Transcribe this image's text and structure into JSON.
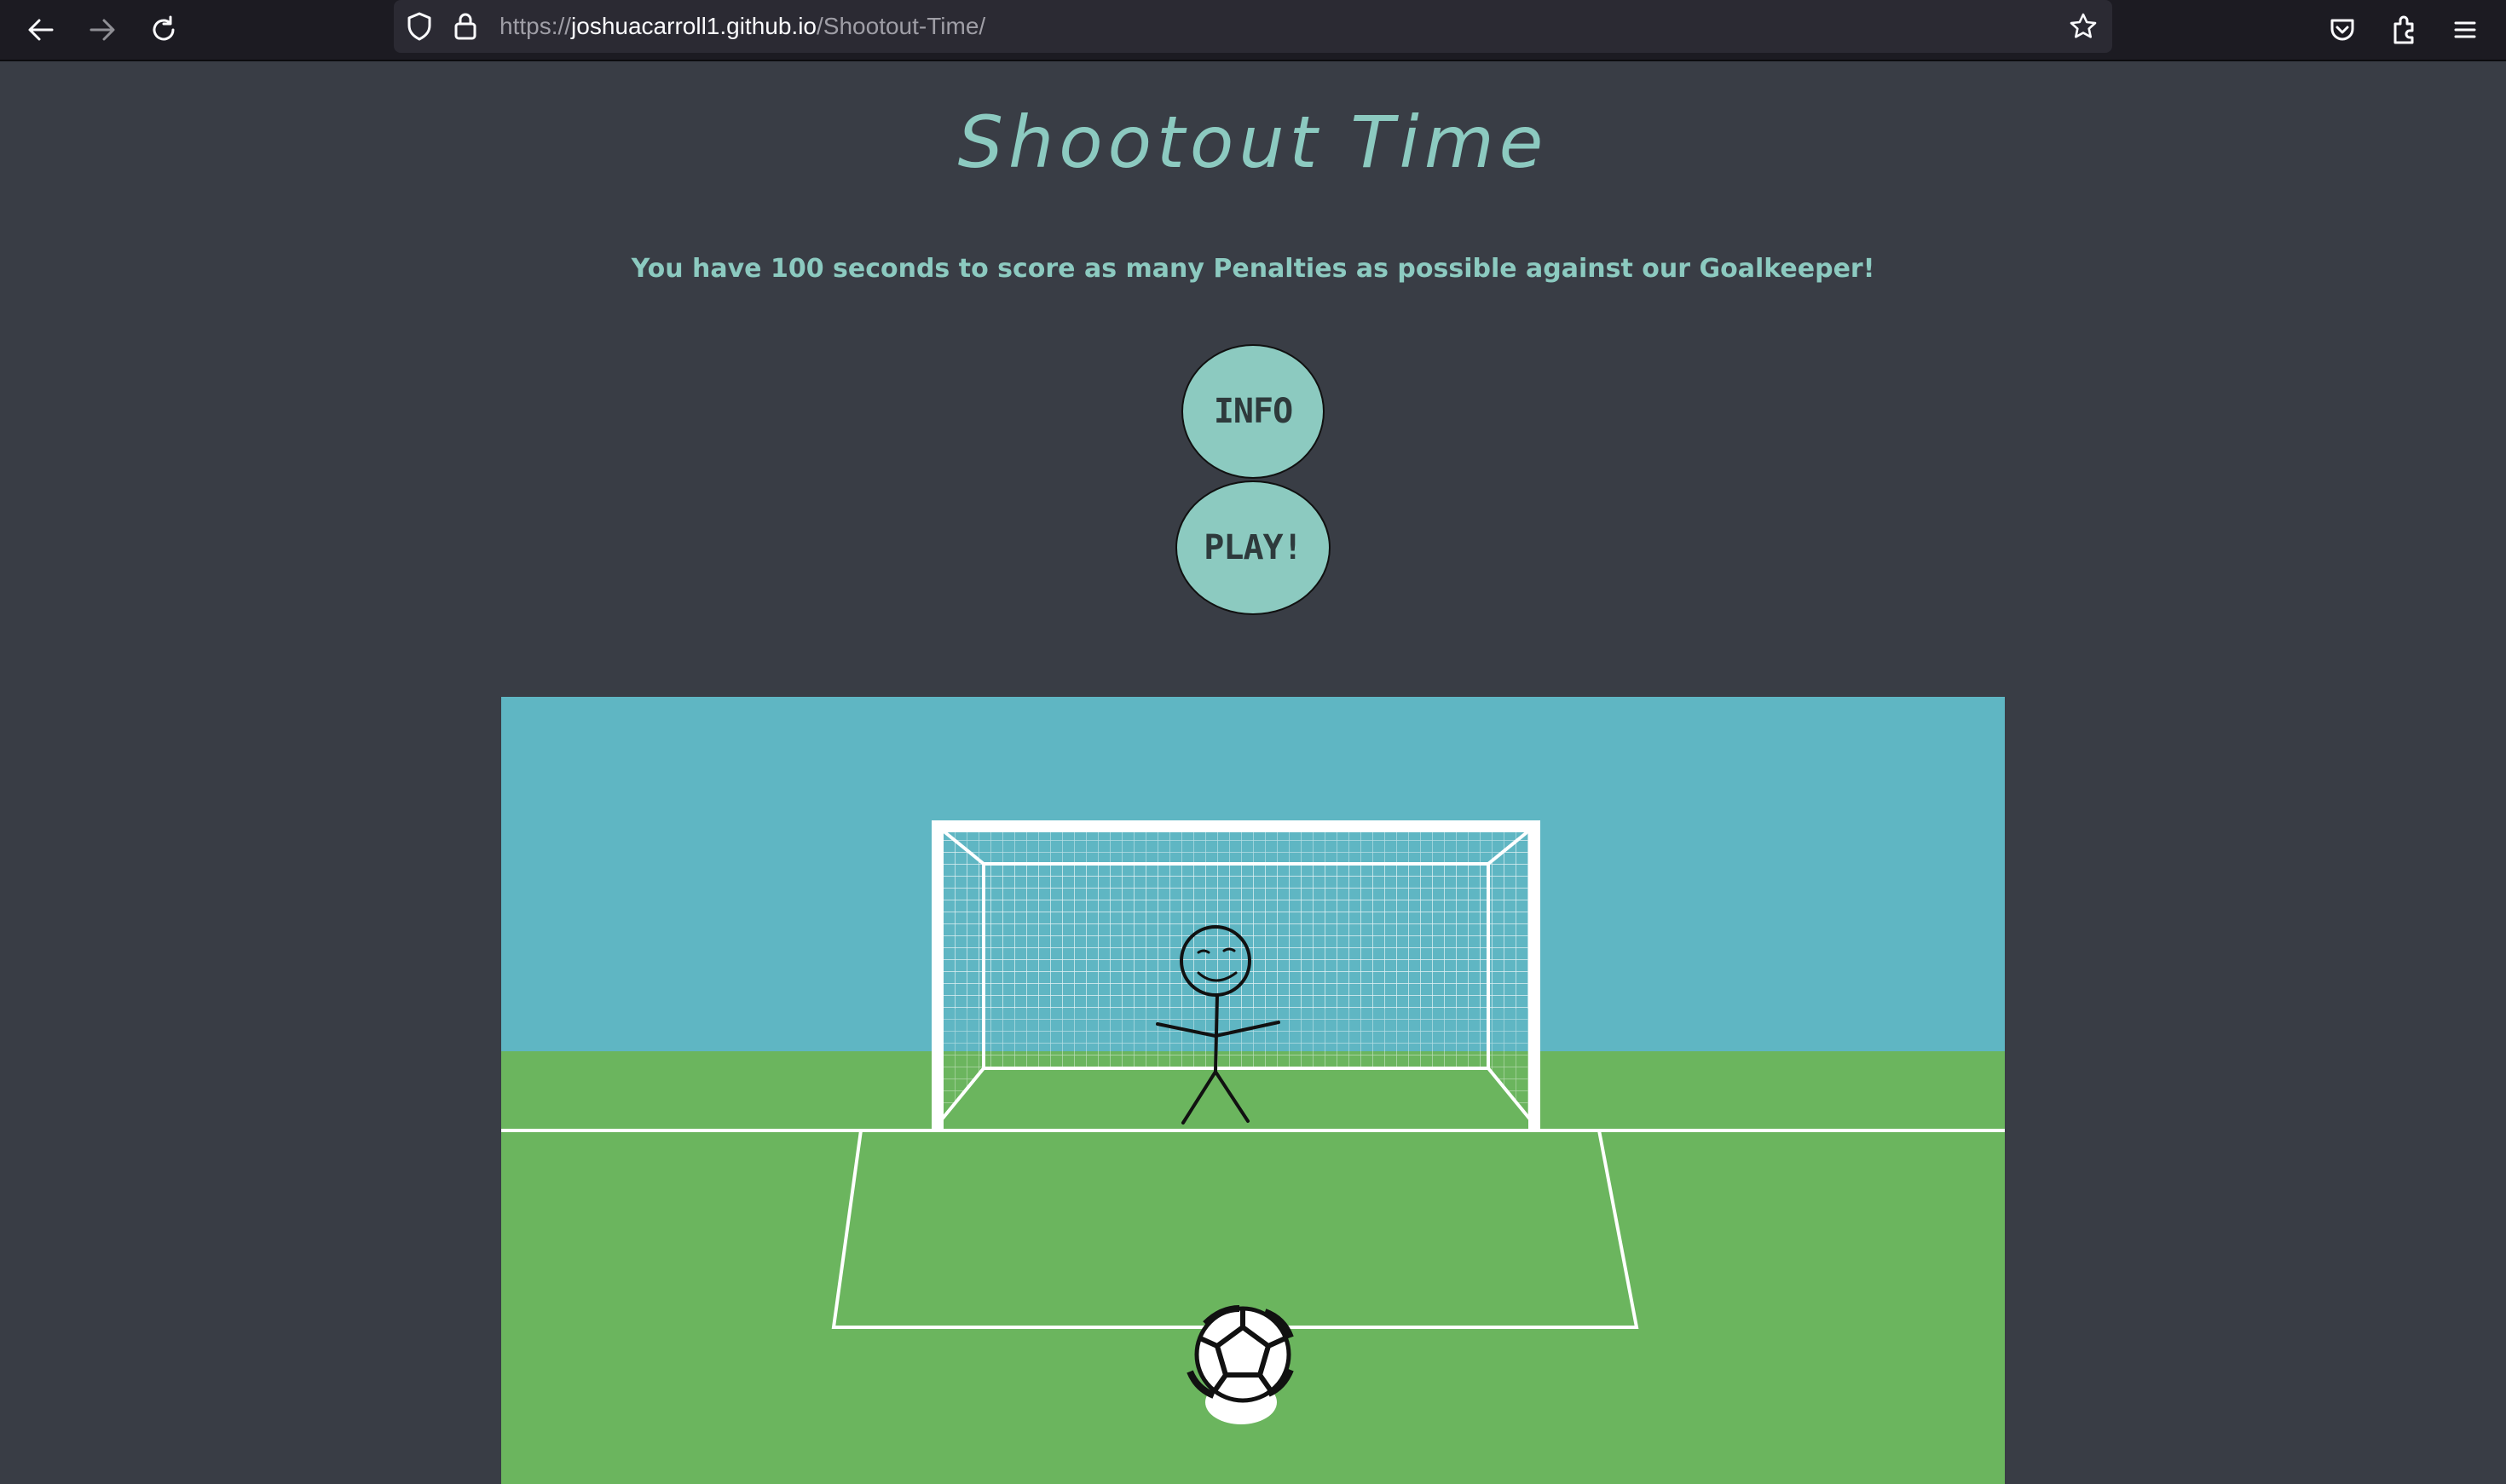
{
  "browser": {
    "url_scheme": "https://",
    "url_host": "joshuacarroll1.github.io",
    "url_path": "/Shootout-Time/",
    "icons": [
      "back-arrow-icon",
      "forward-arrow-icon",
      "reload-icon",
      "shield-icon",
      "lock-icon",
      "bookmark-star-icon",
      "pocket-icon",
      "extensions-icon",
      "menu-icon"
    ]
  },
  "page": {
    "title": "Shootout Time",
    "subtitle": "You have 100 seconds to score as many Penalties as possible against our Goalkeeper!",
    "info_button": "INFO",
    "play_button": "PLAY!"
  },
  "colors": {
    "background": "#393d45",
    "accent": "#8ccac0",
    "sky": "#5fb6c3",
    "grass": "#6bb55e"
  }
}
